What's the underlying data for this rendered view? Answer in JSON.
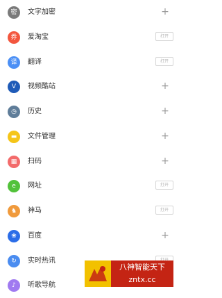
{
  "items": [
    {
      "label": "文字加密",
      "icon_name": "lock-icon",
      "icon_glyph": "密",
      "icon_color": "#7a7a7a",
      "action": "add"
    },
    {
      "label": "爱淘宝",
      "icon_name": "taobao-icon",
      "icon_glyph": "券",
      "icon_color": "#f3563e",
      "action": "open"
    },
    {
      "label": "翻译",
      "icon_name": "translate-icon",
      "icon_glyph": "译",
      "icon_color": "#4b8ff5",
      "action": "open"
    },
    {
      "label": "视频酷站",
      "icon_name": "video-icon",
      "icon_glyph": "V",
      "icon_color": "#1f5bb8",
      "action": "add"
    },
    {
      "label": "历史",
      "icon_name": "clock-icon",
      "icon_glyph": "◷",
      "icon_color": "#5f7d99",
      "action": "add"
    },
    {
      "label": "文件管理",
      "icon_name": "folder-icon",
      "icon_glyph": "▬",
      "icon_color": "#f5c518",
      "action": "add"
    },
    {
      "label": "扫码",
      "icon_name": "qr-scan-icon",
      "icon_glyph": "▦",
      "icon_color": "#f36b6b",
      "action": "add"
    },
    {
      "label": "网址",
      "icon_name": "browser-icon",
      "icon_glyph": "e",
      "icon_color": "#52c23a",
      "action": "open"
    },
    {
      "label": "神马",
      "icon_name": "shenma-icon",
      "icon_glyph": "♞",
      "icon_color": "#f09a3c",
      "action": "open"
    },
    {
      "label": "百度",
      "icon_name": "baidu-paw-icon",
      "icon_glyph": "❀",
      "icon_color": "#2b6de8",
      "action": "add"
    },
    {
      "label": "实时热讯",
      "icon_name": "refresh-icon",
      "icon_glyph": "↻",
      "icon_color": "#4a8cf0",
      "action": "open"
    },
    {
      "label": "听歌导航",
      "icon_name": "music-icon",
      "icon_glyph": "♪",
      "icon_color": "#a07af0",
      "action": "none"
    }
  ],
  "open_label": "打开",
  "add_label": "+",
  "watermark": {
    "line1": "八神智能天下",
    "line2": "zntx.cc"
  }
}
